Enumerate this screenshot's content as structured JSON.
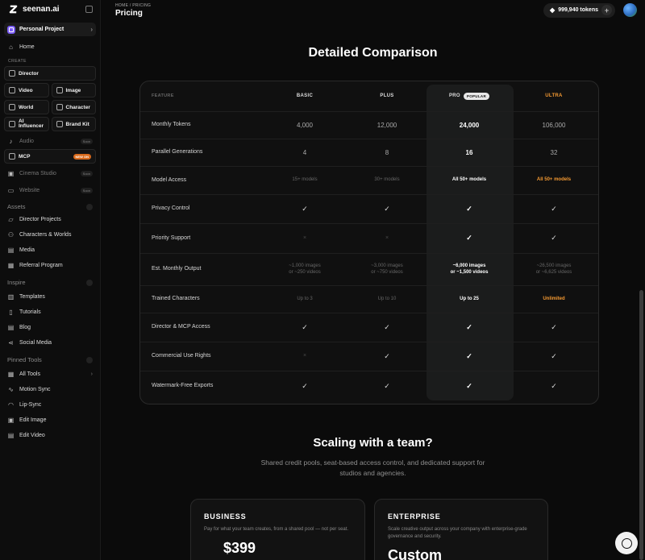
{
  "brand": {
    "name": "seenan.ai"
  },
  "sidebar": {
    "project": "Personal Project",
    "home": "Home",
    "create_label": "CREATE",
    "director": "Director",
    "tiles": [
      "Video",
      "Image",
      "World",
      "Character",
      "AI Influencer",
      "Brand Kit"
    ],
    "audio": "Audio",
    "audio_badge": "Soon",
    "mcp": "MCP",
    "mcp_badge": "NEW ON",
    "cinema": "Cinema Studio",
    "cinema_badge": "Soon",
    "website": "Website",
    "website_badge": "Soon",
    "assets_label": "Assets",
    "assets": [
      "Director Projects",
      "Characters & Worlds",
      "Media",
      "Referral Program"
    ],
    "inspire_label": "Inspire",
    "inspire": [
      "Templates",
      "Tutorials",
      "Blog",
      "Social Media"
    ],
    "pinned_label": "Pinned Tools",
    "pinned": [
      "All Tools",
      "Motion Sync",
      "Lip-Sync",
      "Edit Image",
      "Edit Video"
    ]
  },
  "header": {
    "breadcrumb": "HOME / PRICING",
    "title": "Pricing",
    "tokens": "999,940 tokens"
  },
  "comparison": {
    "title": "Detailed Comparison",
    "headers": [
      "FEATURE",
      "BASIC",
      "PLUS",
      "PRO",
      "ULTRA"
    ],
    "popular": "POPULAR",
    "rows": [
      {
        "feature": "Monthly Tokens",
        "basic": "4,000",
        "plus": "12,000",
        "pro": "24,000",
        "ultra": "106,000"
      },
      {
        "feature": "Parallel Generations",
        "basic": "4",
        "plus": "8",
        "pro": "16",
        "ultra": "32"
      },
      {
        "feature": "Model Access",
        "basic": "15+ models",
        "plus": "30+ models",
        "pro": "All 50+ models",
        "ultra": "All 50+ models"
      },
      {
        "feature": "Privacy Control",
        "basic": "✓",
        "plus": "✓",
        "pro": "✓",
        "ultra": "✓"
      },
      {
        "feature": "Priority Support",
        "basic": "×",
        "plus": "×",
        "pro": "✓",
        "ultra": "✓"
      },
      {
        "feature": "Est. Monthly Output",
        "basic": "~1,000 images",
        "basic2": "or ~250 videos",
        "plus": "~3,000 images",
        "plus2": "or ~750 videos",
        "pro": "~6,000 images",
        "pro2": "or ~1,500 videos",
        "ultra": "~26,500 images",
        "ultra2": "or ~6,625 videos"
      },
      {
        "feature": "Trained Characters",
        "basic": "Up to 3",
        "plus": "Up to 10",
        "pro": "Up to 25",
        "ultra": "Unlimited"
      },
      {
        "feature": "Director & MCP Access",
        "basic": "✓",
        "plus": "✓",
        "pro": "✓",
        "ultra": "✓"
      },
      {
        "feature": "Commercial Use Rights",
        "basic": "×",
        "plus": "✓",
        "pro": "✓",
        "ultra": "✓"
      },
      {
        "feature": "Watermark-Free Exports",
        "basic": "✓",
        "plus": "✓",
        "pro": "✓",
        "ultra": "✓"
      }
    ]
  },
  "team": {
    "title": "Scaling with a team?",
    "subtitle": "Shared credit pools, seat-based access control, and dedicated support for studios and agencies.",
    "business": {
      "title": "BUSINESS",
      "desc": "Pay for what your team creates, from a shared pool — not per seat.",
      "price": "$399"
    },
    "enterprise": {
      "title": "ENTERPRISE",
      "desc": "Scale creative output across your company with enterprise-grade governance and security.",
      "price": "Custom"
    }
  }
}
